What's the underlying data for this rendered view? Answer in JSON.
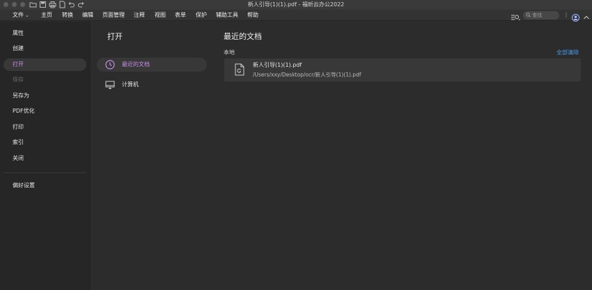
{
  "window": {
    "title": "新人引导(1)(1).pdf - 福昕云办公2022"
  },
  "menubar": {
    "items": [
      "文件",
      "主页",
      "转换",
      "编辑",
      "页面管理",
      "注释",
      "视图",
      "表单",
      "保护",
      "辅助工具",
      "帮助"
    ],
    "search_placeholder": "查找"
  },
  "sidebar": {
    "items": [
      {
        "label": "属性",
        "state": "normal"
      },
      {
        "label": "创建",
        "state": "normal"
      },
      {
        "label": "打开",
        "state": "active"
      },
      {
        "label": "保存",
        "state": "disabled"
      },
      {
        "label": "另存为",
        "state": "normal"
      },
      {
        "label": "PDF优化",
        "state": "normal"
      },
      {
        "label": "打印",
        "state": "normal"
      },
      {
        "label": "索引",
        "state": "normal"
      },
      {
        "label": "关闭",
        "state": "normal"
      }
    ],
    "preferences": "偏好设置"
  },
  "open_panel": {
    "title": "打开",
    "items": [
      {
        "label": "最近的文档",
        "icon": "clock-icon",
        "active": true
      },
      {
        "label": "计算机",
        "icon": "monitor-icon",
        "active": false
      }
    ]
  },
  "recent": {
    "title": "最近的文档",
    "section": "本地",
    "clear_all": "全部清除",
    "files": [
      {
        "name": "新人引导(1)(1).pdf",
        "path": "/Users/xxy/Desktop/ocr/新人引导(1)(1).pdf"
      }
    ]
  },
  "colors": {
    "accent": "#c78de8",
    "link": "#4a9cf0",
    "background": "#2c2c2c",
    "sidebar": "#262626"
  }
}
